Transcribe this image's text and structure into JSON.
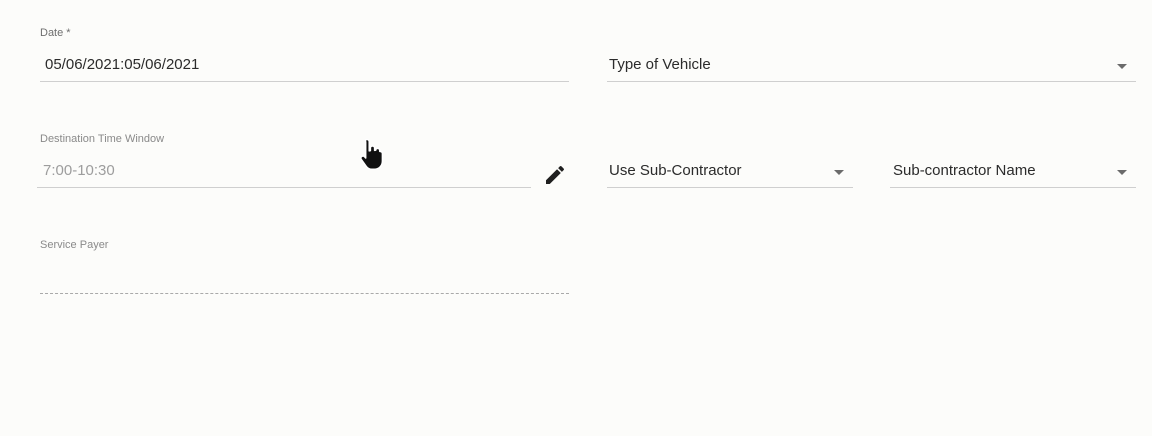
{
  "form": {
    "date": {
      "label": "Date *",
      "value": "05/06/2021:05/06/2021"
    },
    "type_of_vehicle": {
      "placeholder": "Type of Vehicle",
      "icon": "chevron-down-icon"
    },
    "destination_time_window": {
      "label": "Destination Time Window",
      "value": "7:00-10:30",
      "edit_icon": "pencil-icon"
    },
    "use_sub_contractor": {
      "placeholder": "Use Sub-Contractor",
      "icon": "chevron-down-icon"
    },
    "sub_contractor_name": {
      "placeholder": "Sub-contractor Name",
      "icon": "chevron-down-icon"
    },
    "service_payer": {
      "label": "Service Payer",
      "value": ""
    }
  },
  "cursor": {
    "icon": "hand-pointer-icon"
  }
}
